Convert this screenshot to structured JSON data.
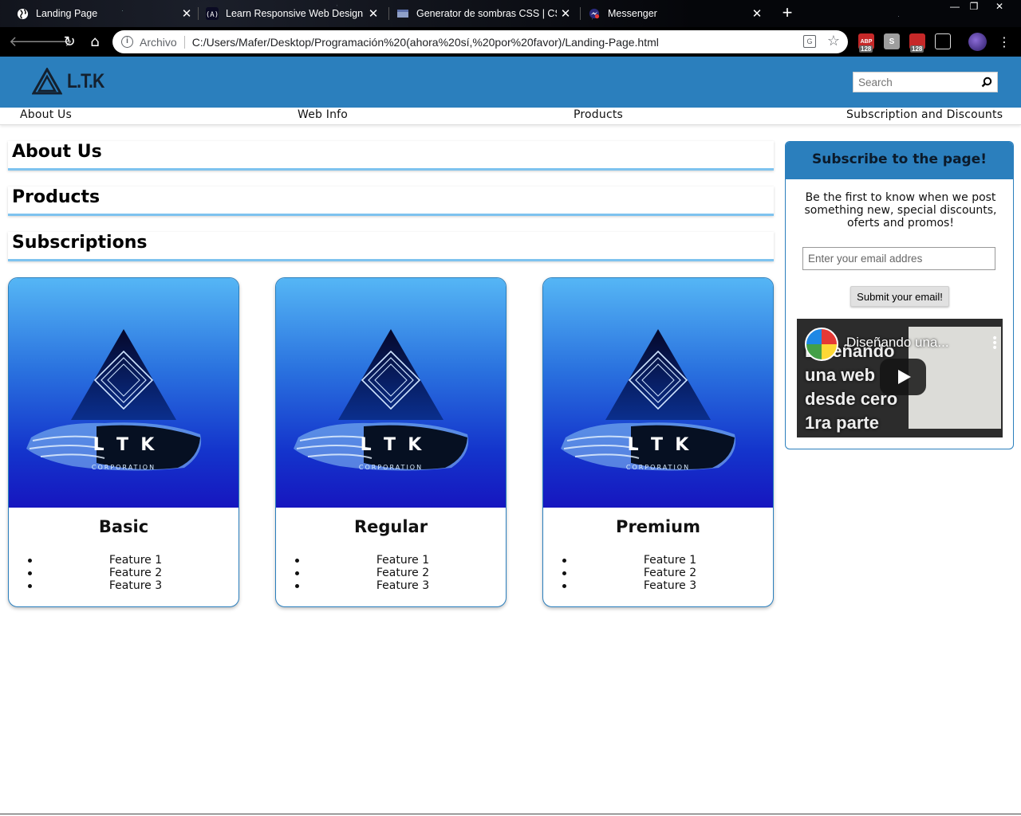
{
  "browser": {
    "tabs": [
      {
        "title": "Landing Page",
        "icon": "globe-icon"
      },
      {
        "title": "Learn Responsive Web Design Pr",
        "icon": "freecodecamp-icon"
      },
      {
        "title": "Generator de sombras CSS | CSS",
        "icon": "cssmatic-icon"
      },
      {
        "title": "Messenger",
        "icon": "messenger-icon"
      }
    ],
    "new_tab": "+",
    "close_glyph": "✕",
    "address": {
      "scheme_label": "Archivo",
      "url": "C:/Users/Mafer/Desktop/Programación%20(ahora%20sí,%20por%20favor)/Landing-Page.html"
    },
    "extension_badges": [
      "128",
      "128"
    ],
    "extension_letters": [
      "ABP",
      "S",
      "",
      ""
    ]
  },
  "site": {
    "logo_text": "L.T.K",
    "search_placeholder": "Search",
    "nav": [
      "About Us",
      "Web Info",
      "Products",
      "Subscription and Discounts"
    ],
    "sections": [
      "About Us",
      "Products",
      "Subscriptions"
    ],
    "cards": [
      {
        "title": "Basic",
        "features": [
          "Feature 1",
          "Feature 2",
          "Feature 3"
        ]
      },
      {
        "title": "Regular",
        "features": [
          "Feature 1",
          "Feature 2",
          "Feature 3"
        ]
      },
      {
        "title": "Premium",
        "features": [
          "Feature 1",
          "Feature 2",
          "Feature 3"
        ]
      }
    ],
    "card_art": {
      "letters": "L  T  K",
      "corporation": "CORPORATION"
    },
    "sidebar": {
      "heading": "Subscribe to the page!",
      "text": "Be the first to know when we post something new, special discounts, oferts and promos!",
      "email_placeholder": "Enter your email addres",
      "submit_label": "Submit your email!",
      "video": {
        "title": "Diseñando una...",
        "overlay_lines": [
          "Diseñando",
          "una web",
          "desde cero",
          "1ra parte"
        ]
      }
    },
    "colors": {
      "header": "#2b7fbd",
      "accent": "#7ec3ef"
    }
  }
}
